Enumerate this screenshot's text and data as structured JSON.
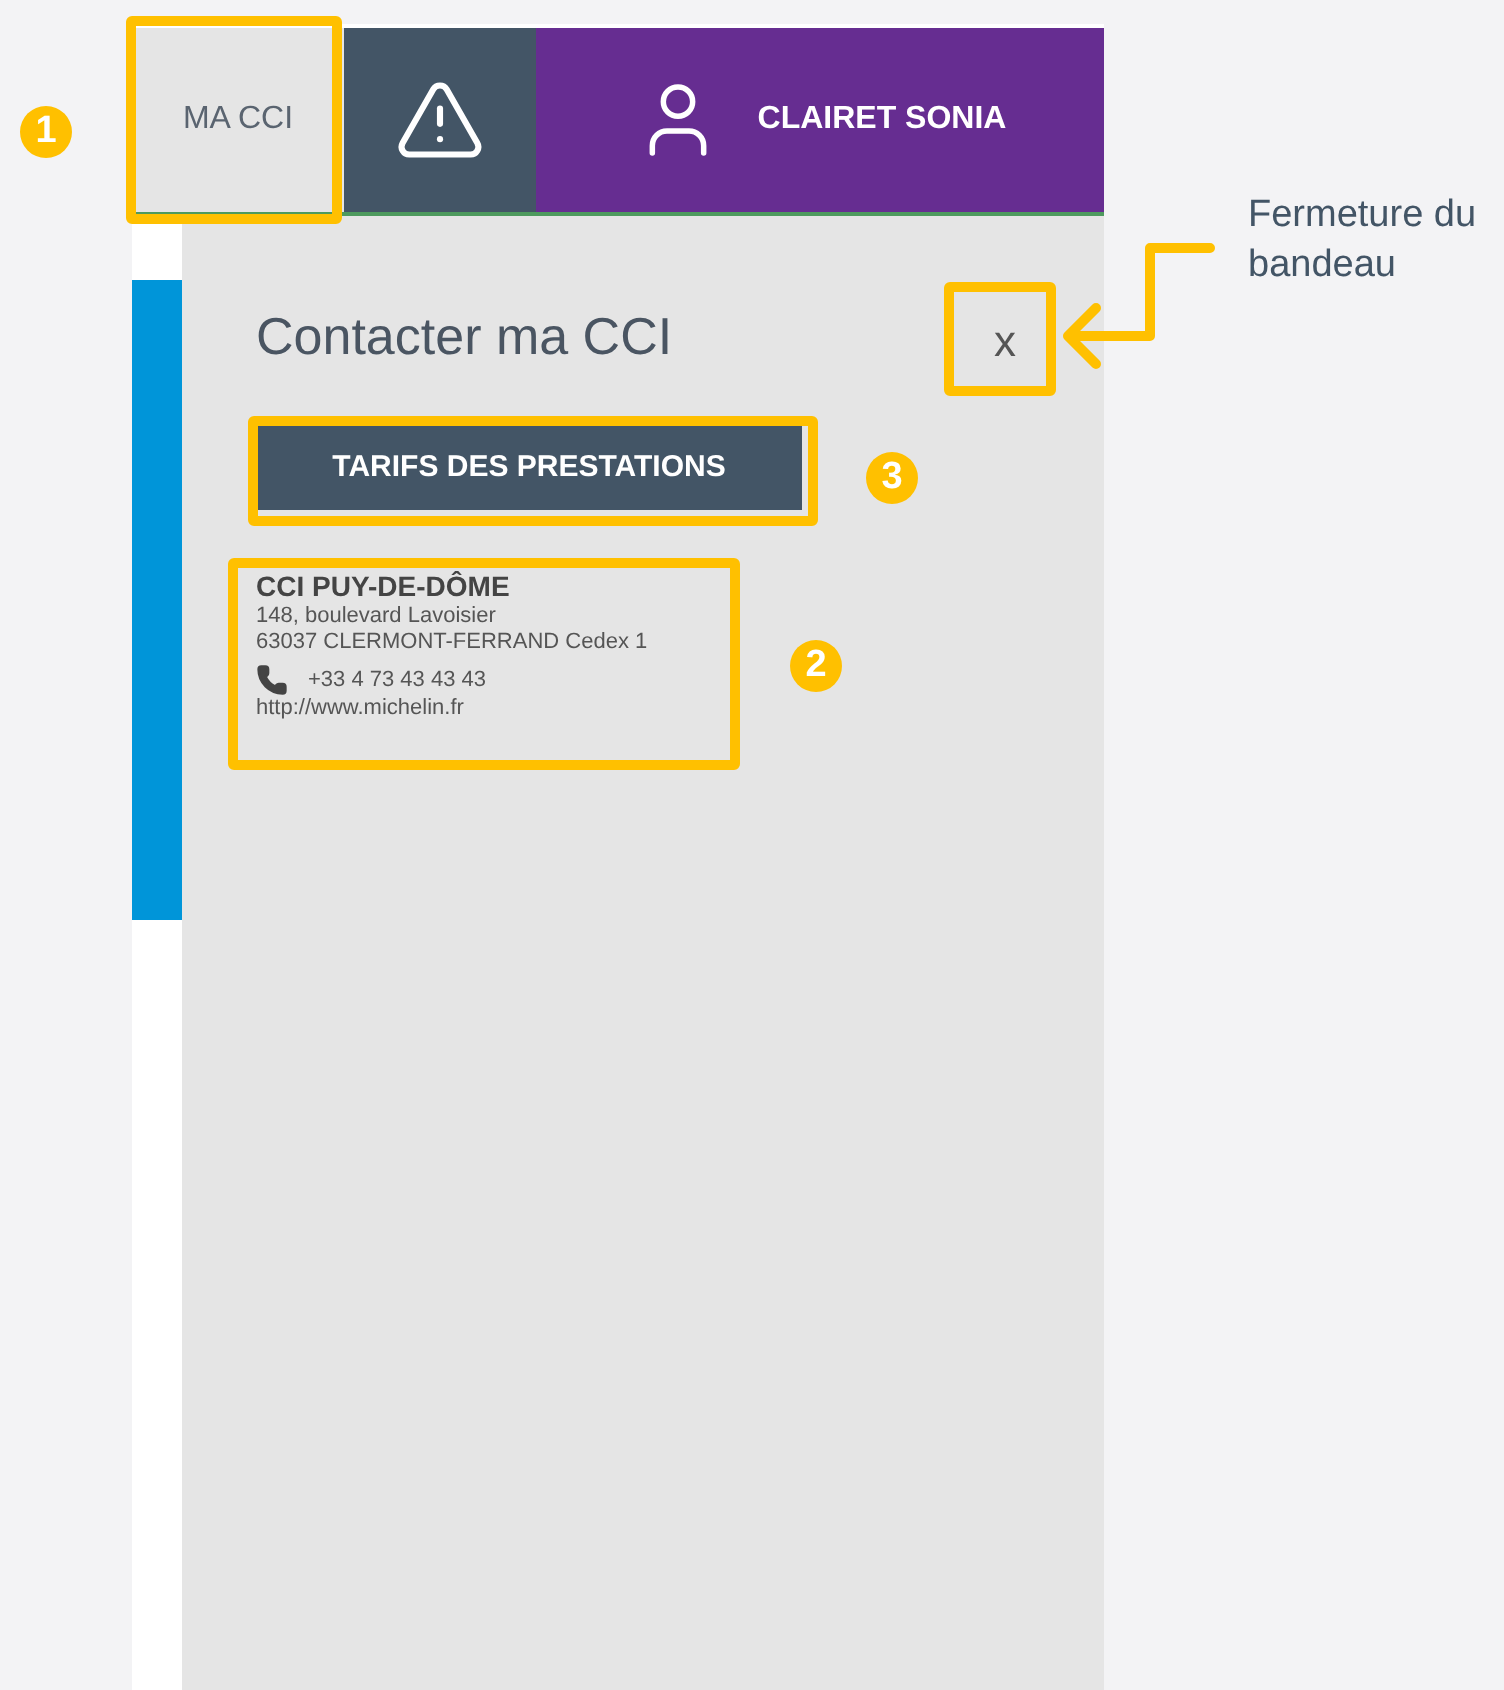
{
  "header": {
    "tabs": [
      {
        "kind": "text",
        "label": "MA CCI",
        "selected": true
      },
      {
        "kind": "alert",
        "selected": false
      },
      {
        "kind": "user",
        "label": "CLAIRET SONIA",
        "selected": false
      }
    ]
  },
  "panel": {
    "title": "Contacter ma CCI",
    "close": "x",
    "button": "TARIFS DES PRESTATIONS",
    "contact": {
      "name": "CCI PUY-DE-DÔME",
      "address": [
        "148, boulevard Lavoisier",
        "63037 CLERMONT-FERRAND Cedex 1"
      ],
      "phone": "+33 4 73 43 43 43",
      "website": "http://www.michelin.fr"
    }
  },
  "annotations": [
    {
      "label": "1"
    },
    {
      "label": "2"
    },
    {
      "label": "3"
    }
  ],
  "callout": "Fermeture du bandeau"
}
